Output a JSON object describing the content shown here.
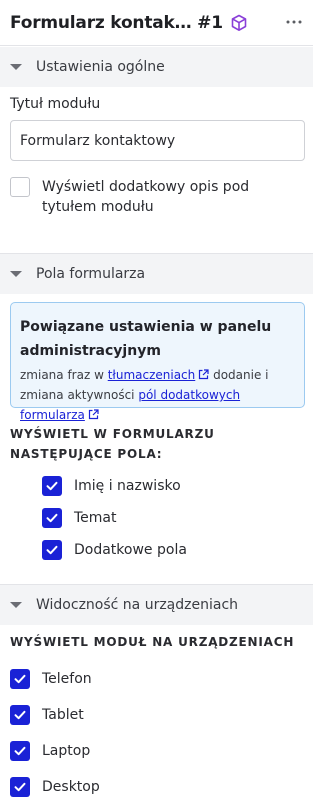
{
  "header": {
    "title": "Formularz kontak… #1",
    "module_icon": "cube-icon",
    "more_icon": "more-horizontal-icon"
  },
  "sections": {
    "general": {
      "label": "Ustawienia ogólne"
    },
    "form_fields": {
      "label": "Pola formularza"
    },
    "visibility": {
      "label": "Widoczność na urządzeniach"
    }
  },
  "general": {
    "module_title_label": "Tytuł modułu",
    "module_title_value": "Formularz kontaktowy",
    "extra_description_label": "Wyświetl dodatkowy opis pod tytułem modułu",
    "extra_description_checked": false
  },
  "form_fields": {
    "info_title": "Powiązane ustawienia w panelu administracyjnym",
    "info_text_1": "zmiana fraz w",
    "info_link_1": "tłumaczeniach",
    "info_text_2": "dodanie i zmiana aktywności",
    "info_link_2": "pól dodatkowych formularza",
    "fields_heading": "WYŚWIETL W FORMULARZU NASTĘPUJĄCE POLA:",
    "fields": [
      {
        "label": "Imię i nazwisko",
        "checked": true
      },
      {
        "label": "Temat",
        "checked": true
      },
      {
        "label": "Dodatkowe pola",
        "checked": true
      }
    ]
  },
  "visibility": {
    "heading": "WYŚWIETL MODUŁ NA URZĄDZENIACH",
    "devices": [
      {
        "label": "Telefon",
        "checked": true
      },
      {
        "label": "Tablet",
        "checked": true
      },
      {
        "label": "Laptop",
        "checked": true
      },
      {
        "label": "Desktop",
        "checked": true
      }
    ]
  },
  "colors": {
    "accent": "#1a22d6",
    "cube_icon": "#8a3fd8",
    "info_bg": "#eef6fd",
    "info_border": "#9ccaf0",
    "section_bg": "#f3f4f6"
  }
}
